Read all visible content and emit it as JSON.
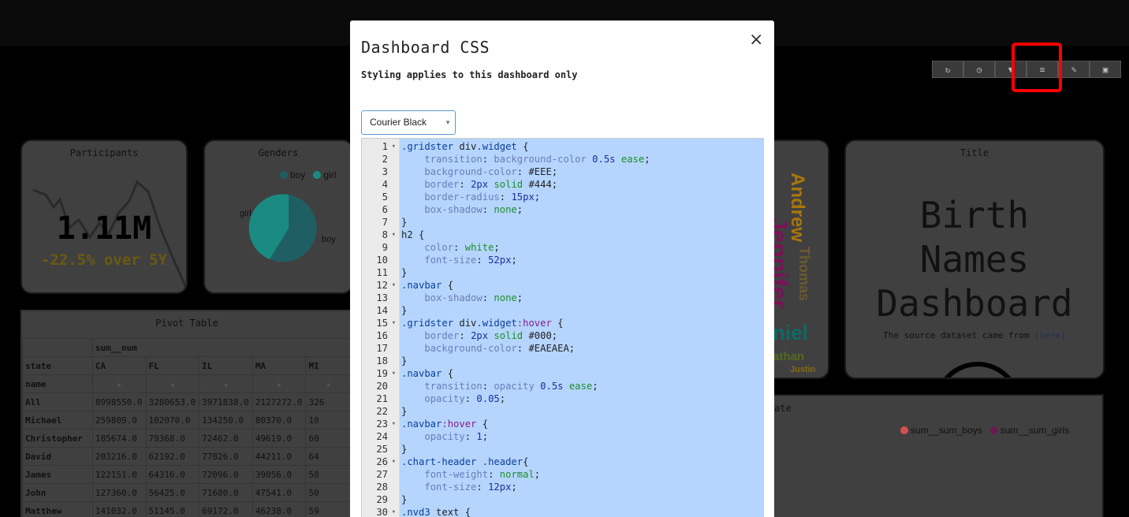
{
  "toolbar": {
    "icons": [
      "refresh-icon",
      "clock-icon",
      "filter-icon",
      "css-icon",
      "edit-icon",
      "save-icon"
    ],
    "highlight_color": "#ff0000"
  },
  "widgets": {
    "participants": {
      "title": "Participants",
      "value": "1.11M",
      "delta": "-22.5% over 5Y"
    },
    "genders": {
      "title": "Genders",
      "legend": [
        {
          "label": "boy",
          "color": "#1f5f64"
        },
        {
          "label": "girl",
          "color": "#1a8b82"
        }
      ],
      "slice_labels": [
        "girl",
        "boy"
      ],
      "values": {
        "boy": 0.59,
        "girl": 0.41
      }
    },
    "pivot": {
      "title": "Pivot Table",
      "metric": "sum__num",
      "col_label": "state",
      "row_label": "name",
      "states": [
        "CA",
        "FL",
        "IL",
        "MA",
        "MI"
      ],
      "rows": [
        {
          "name": "All",
          "values": [
            "8998550.0",
            "3280653.0",
            "3971838.0",
            "2127272.0",
            "326"
          ]
        },
        {
          "name": "Michael",
          "values": [
            "259809.0",
            "102070.0",
            "134250.0",
            "80370.0",
            "10"
          ]
        },
        {
          "name": "Christopher",
          "values": [
            "185674.0",
            "79368.0",
            "72462.0",
            "49619.0",
            "60"
          ]
        },
        {
          "name": "David",
          "values": [
            "203216.0",
            "62192.0",
            "77826.0",
            "44211.0",
            "64"
          ]
        },
        {
          "name": "James",
          "values": [
            "122151.0",
            "64316.0",
            "72096.0",
            "39056.0",
            "58"
          ]
        },
        {
          "name": "John",
          "values": [
            "127360.0",
            "56425.0",
            "71680.0",
            "47541.0",
            "50"
          ]
        },
        {
          "name": "Matthew",
          "values": [
            "141032.0",
            "51145.0",
            "69172.0",
            "46238.0",
            "59"
          ]
        }
      ]
    },
    "wordcloud": {
      "words": [
        "Andrew",
        "Jennifer",
        "Thomas",
        "niel",
        "athan",
        "Justin"
      ]
    },
    "title_widget": {
      "title": "Title",
      "heading_lines": [
        "Birth",
        "Names",
        "Dashboard"
      ],
      "source_text": "The source dataset came from ",
      "source_link": "[here]"
    },
    "line_widget": {
      "title_fragment": "ate",
      "legend": [
        {
          "label": "sum__sum_boys",
          "color": "#d64f4f"
        },
        {
          "label": "sum__sum_girls",
          "color": "#6b1a4f"
        }
      ]
    }
  },
  "modal": {
    "title": "Dashboard CSS",
    "subtitle": "Styling applies to this dashboard only",
    "close_label": "×",
    "theme_value": "Courier Black",
    "code_lines": [
      [
        [
          "sel",
          ".gridster "
        ],
        [
          "",
          "div"
        ],
        [
          "sel",
          ".widget"
        ],
        [
          "",
          " {"
        ]
      ],
      [
        [
          "",
          "    "
        ],
        [
          "prop",
          "transition"
        ],
        [
          "",
          ": "
        ],
        [
          "prop",
          "background-color"
        ],
        [
          "",
          " "
        ],
        [
          "num2",
          "0.5s"
        ],
        [
          "",
          " "
        ],
        [
          "val",
          "ease"
        ],
        [
          "",
          ";"
        ]
      ],
      [
        [
          "",
          "    "
        ],
        [
          "prop",
          "background-color"
        ],
        [
          "",
          ": "
        ],
        [
          "",
          "#EEE"
        ],
        [
          "",
          ";"
        ]
      ],
      [
        [
          "",
          "    "
        ],
        [
          "prop",
          "border"
        ],
        [
          "",
          ": "
        ],
        [
          "num2",
          "2px"
        ],
        [
          "",
          " "
        ],
        [
          "val",
          "solid"
        ],
        [
          "",
          " #444;"
        ]
      ],
      [
        [
          "",
          "    "
        ],
        [
          "prop",
          "border-radius"
        ],
        [
          "",
          ": "
        ],
        [
          "num2",
          "15px"
        ],
        [
          "",
          ";"
        ]
      ],
      [
        [
          "",
          "    "
        ],
        [
          "prop",
          "box-shadow"
        ],
        [
          "",
          ": "
        ],
        [
          "val",
          "none"
        ],
        [
          "",
          ";"
        ]
      ],
      [
        [
          "",
          "}"
        ]
      ],
      [
        [
          "",
          "h2 {"
        ]
      ],
      [
        [
          "",
          "    "
        ],
        [
          "prop",
          "color"
        ],
        [
          "",
          ": "
        ],
        [
          "val",
          "white"
        ],
        [
          "",
          ";"
        ]
      ],
      [
        [
          "",
          "    "
        ],
        [
          "prop",
          "font-size"
        ],
        [
          "",
          ": "
        ],
        [
          "num2",
          "52px"
        ],
        [
          "",
          ";"
        ]
      ],
      [
        [
          "",
          "}"
        ]
      ],
      [
        [
          "sel",
          ".navbar"
        ],
        [
          "",
          " {"
        ]
      ],
      [
        [
          "",
          "    "
        ],
        [
          "prop",
          "box-shadow"
        ],
        [
          "",
          ": "
        ],
        [
          "val",
          "none"
        ],
        [
          "",
          ";"
        ]
      ],
      [
        [
          "",
          "}"
        ]
      ],
      [
        [
          "sel",
          ".gridster "
        ],
        [
          "",
          "div"
        ],
        [
          "sel",
          ".widget"
        ],
        [
          "pseudo",
          ":hover"
        ],
        [
          "",
          " {"
        ]
      ],
      [
        [
          "",
          "    "
        ],
        [
          "prop",
          "border"
        ],
        [
          "",
          ": "
        ],
        [
          "num2",
          "2px"
        ],
        [
          "",
          " "
        ],
        [
          "val",
          "solid"
        ],
        [
          "",
          " #000;"
        ]
      ],
      [
        [
          "",
          "    "
        ],
        [
          "prop",
          "background-color"
        ],
        [
          "",
          ": #EAEAEA;"
        ]
      ],
      [
        [
          "",
          "}"
        ]
      ],
      [
        [
          "sel",
          ".navbar"
        ],
        [
          "",
          " {"
        ]
      ],
      [
        [
          "",
          "    "
        ],
        [
          "prop",
          "transition"
        ],
        [
          "",
          ": "
        ],
        [
          "prop",
          "opacity"
        ],
        [
          "",
          " "
        ],
        [
          "num2",
          "0.5s"
        ],
        [
          "",
          " "
        ],
        [
          "val",
          "ease"
        ],
        [
          "",
          ";"
        ]
      ],
      [
        [
          "",
          "    "
        ],
        [
          "prop",
          "opacity"
        ],
        [
          "",
          ": "
        ],
        [
          "num2",
          "0.05"
        ],
        [
          "",
          ";"
        ]
      ],
      [
        [
          "",
          "}"
        ]
      ],
      [
        [
          "sel",
          ".navbar"
        ],
        [
          "pseudo",
          ":hover"
        ],
        [
          "",
          " {"
        ]
      ],
      [
        [
          "",
          "    "
        ],
        [
          "prop",
          "opacity"
        ],
        [
          "",
          ": "
        ],
        [
          "num2",
          "1"
        ],
        [
          "",
          ";"
        ]
      ],
      [
        [
          "",
          "}"
        ]
      ],
      [
        [
          "sel",
          ".chart-header "
        ],
        [
          "sel",
          ".header"
        ],
        [
          "",
          "{"
        ]
      ],
      [
        [
          "",
          "    "
        ],
        [
          "prop",
          "font-weight"
        ],
        [
          "",
          ": "
        ],
        [
          "val",
          "normal"
        ],
        [
          "",
          ";"
        ]
      ],
      [
        [
          "",
          "    "
        ],
        [
          "prop",
          "font-size"
        ],
        [
          "",
          ": "
        ],
        [
          "num2",
          "12px"
        ],
        [
          "",
          ";"
        ]
      ],
      [
        [
          "",
          "}"
        ]
      ],
      [
        [
          "sel",
          ".nvd3 "
        ],
        [
          "",
          "text {"
        ]
      ]
    ],
    "fold_lines": [
      1,
      8,
      12,
      15,
      19,
      23,
      26,
      30
    ]
  }
}
